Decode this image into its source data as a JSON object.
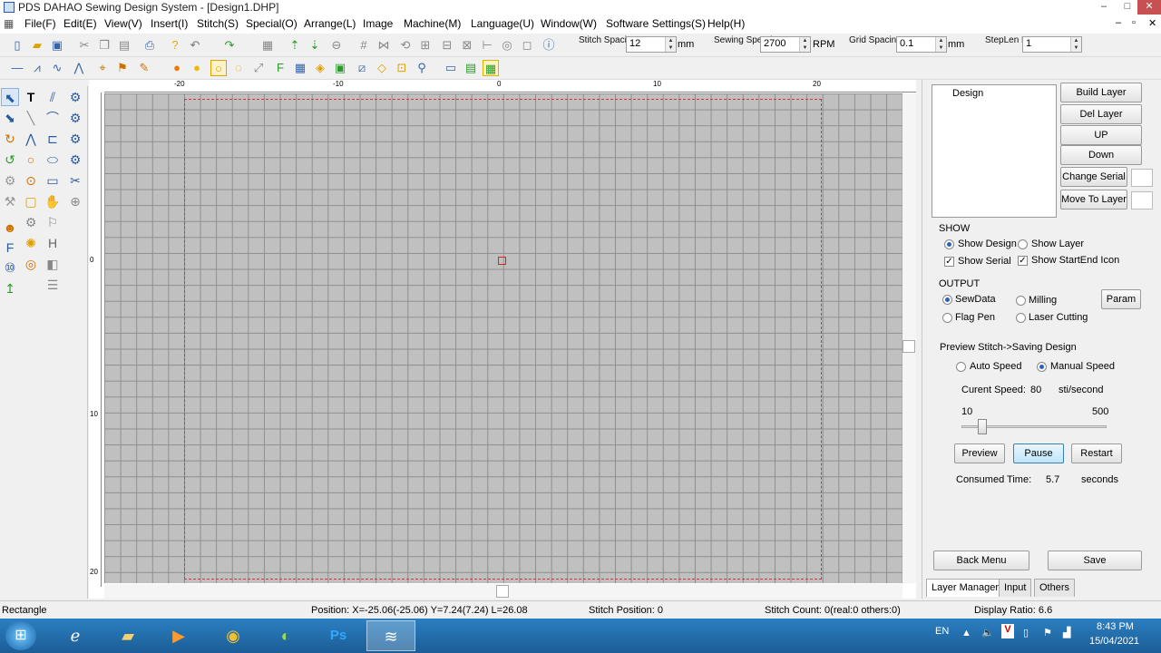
{
  "window": {
    "title": "PDS DAHAO Sewing Design System - [Design1.DHP]",
    "minimize": "–",
    "maximize": "□",
    "close": "✕"
  },
  "menu": [
    "File(F)",
    "Edit(E)",
    "View(V)",
    "Insert(I)",
    "Stitch(S)",
    "Special(O)",
    "Arrange(L)",
    "Image",
    "Machine(M)",
    "Language(U)",
    "Window(W)",
    "Software Settings(S)",
    "Help(H)"
  ],
  "params": {
    "stitch_spacing_label": "Stitch Spacing",
    "stitch_spacing": "12",
    "stitch_spacing_unit": "mm",
    "sewing_speed_label": "Sewing Speed",
    "sewing_speed": "2700",
    "sewing_speed_unit": "RPM",
    "grid_spacing_label": "Grid Spacing",
    "grid_spacing": "0.1",
    "grid_spacing_unit": "mm",
    "steplen_label": "StepLen Rate",
    "steplen": "1"
  },
  "ruler": {
    "top": [
      "-20",
      "-10",
      "0",
      "10",
      "20"
    ],
    "left": [
      "0",
      "10",
      "20"
    ]
  },
  "panel": {
    "layer_list": [
      "Design"
    ],
    "build_layer": "Build Layer",
    "del_layer": "Del Layer",
    "up": "UP",
    "down": "Down",
    "change_serial": "Change Serial",
    "move_to_layer": "Move To Layer",
    "show_title": "SHOW",
    "show_design": "Show Design",
    "show_layer": "Show Layer",
    "show_serial": "Show Serial",
    "show_startend": "Show StartEnd Icon",
    "output_title": "OUTPUT",
    "sewdata": "SewData",
    "milling": "Milling",
    "param": "Param",
    "flag_pen": "Flag Pen",
    "laser_cutting": "Laser Cutting",
    "preview_title": "Preview Stitch->Saving Design",
    "auto_speed": "Auto Speed",
    "manual_speed": "Manual Speed",
    "current_speed_label": "Curent Speed:",
    "current_speed": "80",
    "speed_unit": "sti/second",
    "slider_min": "10",
    "slider_max": "500",
    "slider_value_fraction": 0.145,
    "preview": "Preview",
    "pause": "Pause",
    "restart": "Restart",
    "consumed_time_label": "Consumed Time:",
    "consumed_time": "5.7",
    "consumed_time_unit": "seconds",
    "back_menu": "Back Menu",
    "save": "Save",
    "tabs": [
      "Layer Manager",
      "Input",
      "Others"
    ]
  },
  "status": {
    "tool": "Rectangle",
    "position": "Position: X=-25.06(-25.06) Y=7.24(7.24) L=26.08",
    "stitch_position": "Stitch Position: 0",
    "stitch_count": "Stitch Count: 0(real:0 others:0)",
    "display_ratio": "Display Ratio: 6.6"
  },
  "taskbar": {
    "lang": "EN",
    "time": "8:43 PM",
    "date": "15/04/2021"
  },
  "colors": {
    "grid": "#c0c0c0",
    "work_boundary": "#e03030",
    "taskbar": "#1c5d95"
  }
}
